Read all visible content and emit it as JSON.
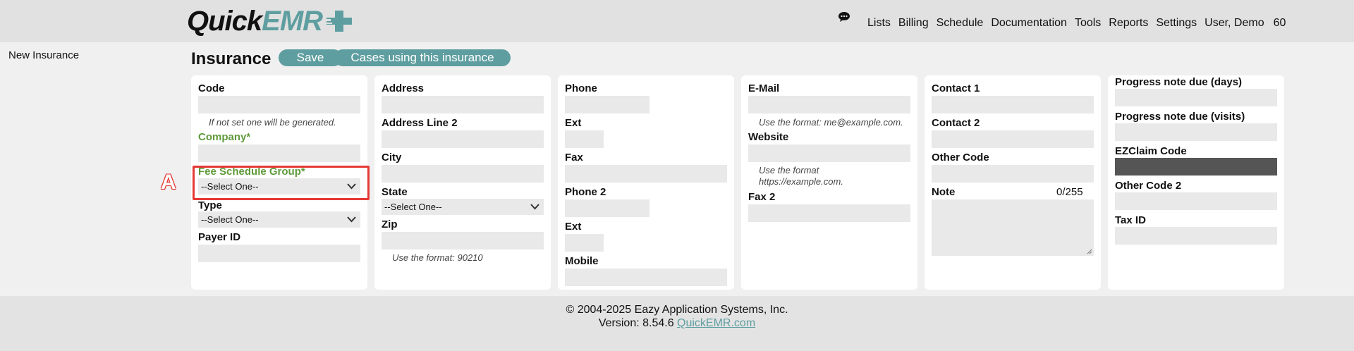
{
  "header": {
    "logo": {
      "part1": "Quick",
      "part2": "EMR"
    },
    "icon": "chat-bubble-icon",
    "nav": [
      "Lists",
      "Billing",
      "Schedule",
      "Documentation",
      "Tools",
      "Reports",
      "Settings",
      "User, Demo",
      "60"
    ]
  },
  "sidebar": {
    "label": "New Insurance"
  },
  "main": {
    "title": "Insurance",
    "save_label": "Save",
    "cases_label": "Cases using this insurance",
    "col1": {
      "code_label": "Code",
      "code_hint": "If not set one will be generated.",
      "company_label": "Company*",
      "fee_label": "Fee Schedule Group*",
      "fee_value": "--Select One--",
      "type_label": "Type",
      "type_value": "--Select One--",
      "payer_label": "Payer ID"
    },
    "col2": {
      "address_label": "Address",
      "address2_label": "Address Line 2",
      "city_label": "City",
      "state_label": "State",
      "state_value": "--Select One--",
      "zip_label": "Zip",
      "zip_hint": "Use the format: 90210"
    },
    "col3": {
      "phone_label": "Phone",
      "ext_label": "Ext",
      "fax_label": "Fax",
      "phone2_label": "Phone 2",
      "ext2_label": "Ext",
      "mobile_label": "Mobile"
    },
    "col4": {
      "email_label": "E-Mail",
      "email_hint": "Use the format: me@example.com.",
      "website_label": "Website",
      "website_hint1": "Use the format",
      "website_hint2": "https://example.com.",
      "fax2_label": "Fax 2"
    },
    "col5": {
      "contact1_label": "Contact 1",
      "contact2_label": "Contact 2",
      "othercode_label": "Other Code",
      "note_label": "Note",
      "note_count": "0/255"
    },
    "col6": {
      "progress_days_label": "Progress note due (days)",
      "progress_visits_label": "Progress note due (visits)",
      "ezclaim_label": "EZClaim Code",
      "othercode2_label": "Other Code 2",
      "taxid_label": "Tax ID"
    }
  },
  "annotation": {
    "marker": "A",
    "color": "#e53935"
  },
  "footer": {
    "copyright": "© 2004-2025 Eazy Application Systems, Inc.",
    "version_prefix": "Version: 8.54.6 ",
    "version_link": "QuickEMR.com"
  },
  "colors": {
    "accent": "#5f9ea0",
    "required": "#5f9a3c"
  }
}
